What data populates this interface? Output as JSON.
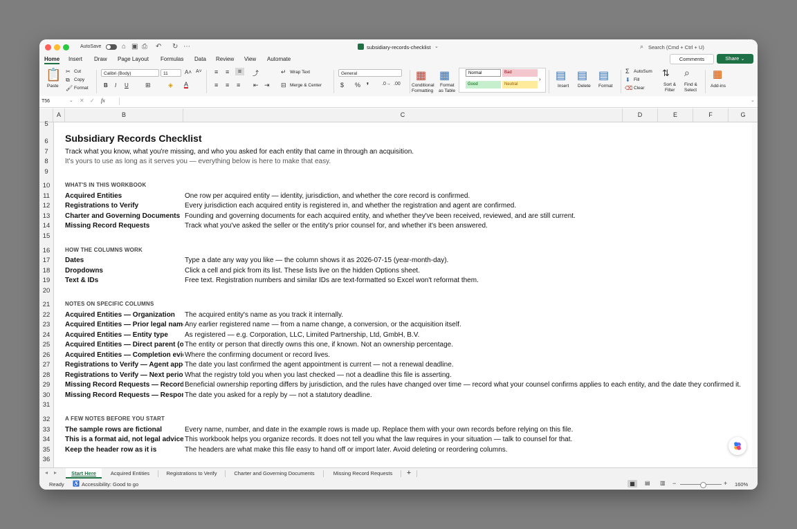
{
  "window": {
    "autosave_label": "AutoSave",
    "file_name": "subsidiary-records-checklist",
    "search_placeholder": "Search (Cmd + Ctrl + U)",
    "comments_label": "Comments",
    "share_label": "Share"
  },
  "menu": [
    "Home",
    "Insert",
    "Draw",
    "Page Layout",
    "Formulas",
    "Data",
    "Review",
    "View",
    "Automate"
  ],
  "ribbon": {
    "paste": "Paste",
    "cut": "Cut",
    "copy": "Copy",
    "format_painter": "Format",
    "font_name": "Calibri (Body)",
    "font_size": "11",
    "wrap_text": "Wrap Text",
    "merge_center": "Merge & Center",
    "number_format": "General",
    "conditional_formatting_1": "Conditional",
    "conditional_formatting_2": "Formatting",
    "format_as_table_1": "Format",
    "format_as_table_2": "as Table",
    "styles": {
      "normal": "Normal",
      "bad": "Bad",
      "good": "Good",
      "neutral": "Neutral"
    },
    "insert": "Insert",
    "delete": "Delete",
    "format": "Format",
    "autosum": "AutoSum",
    "fill": "Fill",
    "clear": "Clear",
    "sort_filter_1": "Sort &",
    "sort_filter_2": "Filter",
    "find_select_1": "Find &",
    "find_select_2": "Select",
    "addins": "Add-ins"
  },
  "formula_bar": {
    "cell_ref": "T56",
    "fx": "fx",
    "value": ""
  },
  "columns": [
    "A",
    "B",
    "C",
    "D",
    "E",
    "F",
    "G"
  ],
  "rows": [
    "5",
    "6",
    "7",
    "8",
    "9",
    "10",
    "11",
    "12",
    "13",
    "14",
    "15",
    "16",
    "17",
    "18",
    "19",
    "20",
    "21",
    "22",
    "23",
    "24",
    "25",
    "26",
    "27",
    "28",
    "29",
    "30",
    "31",
    "32",
    "33",
    "34",
    "35",
    "36"
  ],
  "content": {
    "title": "Subsidiary Records Checklist",
    "intro": "Track what you know, what you're missing, and who you asked for each entity that came in through an acquisition.",
    "intro2": "It's yours to use as long as it serves you — everything below is here to make that easy.",
    "sec1": "WHAT'S IN THIS WORKBOOK",
    "r11b": "Acquired Entities",
    "r11c": "One row per acquired entity — identity, jurisdiction, and whether the core record is confirmed.",
    "r12b": "Registrations to Verify",
    "r12c": "Every jurisdiction each acquired entity is registered in, and whether the registration and agent are confirmed.",
    "r13b": "Charter and Governing Documents",
    "r13c": "Founding and governing documents for each acquired entity, and whether they've been received, reviewed, and are still current.",
    "r14b": "Missing Record Requests",
    "r14c": "Track what you've asked the seller or the entity's prior counsel for, and whether it's been answered.",
    "sec2": "HOW THE COLUMNS WORK",
    "r17b": "Dates",
    "r17c": "Type a date any way you like — the column shows it as 2026-07-15 (year-month-day).",
    "r18b": "Dropdowns",
    "r18c": "Click a cell and pick from its list. These lists live on the hidden Options sheet.",
    "r19b": "Text & IDs",
    "r19c": "Free text. Registration numbers and similar IDs are text-formatted so Excel won't reformat them.",
    "sec3": "NOTES ON SPECIFIC COLUMNS",
    "r22b": "Acquired Entities — Organization",
    "r22c": "The acquired entity's name as you track it internally.",
    "r23b": "Acquired Entities — Prior legal name",
    "r23c": "Any earlier registered name — from a name change, a conversion, or the acquisition itself.",
    "r24b": "Acquired Entities — Entity type",
    "r24c": "As registered — e.g. Corporation, LLC, Limited Partnership, Ltd, GmbH, B.V.",
    "r25b": "Acquired Entities — Direct parent (ow",
    "r25c": "The entity or person that directly owns this one, if known. Not an ownership percentage.",
    "r26b": "Acquired Entities — Completion evide",
    "r26c": "Where the confirming document or record lives.",
    "r27b": "Registrations to Verify — Agent appoi",
    "r27c": "The date you last confirmed the agent appointment is current — not a renewal deadline.",
    "r28b": "Registrations to Verify — Next periodi",
    "r28c": "What the registry told you when you last checked — not a deadline this file is asserting.",
    "r29b": "Missing Record Requests — Record re",
    "r29c": "Beneficial ownership reporting differs by jurisdiction, and the rules have changed over time — record what your counsel confirms applies to each entity, and the date they confirmed it.",
    "r30b": "Missing Record Requests — Response",
    "r30c": "The date you asked for a reply by — not a statutory deadline.",
    "sec4": "A FEW NOTES BEFORE YOU START",
    "r33b": "The sample rows are fictional",
    "r33c": "Every name, number, and date in the example rows is made up. Replace them with your own records before relying on this file.",
    "r34b": "This is a format aid, not legal advice",
    "r34c": "This workbook helps you organize records. It does not tell you what the law requires in your situation — talk to counsel for that.",
    "r35b": "Keep the header row as it is",
    "r35c": "The headers are what make this file easy to hand off or import later. Avoid deleting or reordering columns."
  },
  "sheets": [
    "Start Here",
    "Acquired Entities",
    "Registrations to Verify",
    "Charter and Governing Documents",
    "Missing Record Requests"
  ],
  "add_sheet": "+",
  "status": {
    "ready": "Ready",
    "accessibility": "Accessibility: Good to go",
    "zoom": "160%"
  },
  "colors": {
    "accent_green": "#1e7145",
    "bad_fill": "#f4c7ce",
    "good_fill": "#c6efce",
    "neutral_fill": "#ffeb9c"
  }
}
